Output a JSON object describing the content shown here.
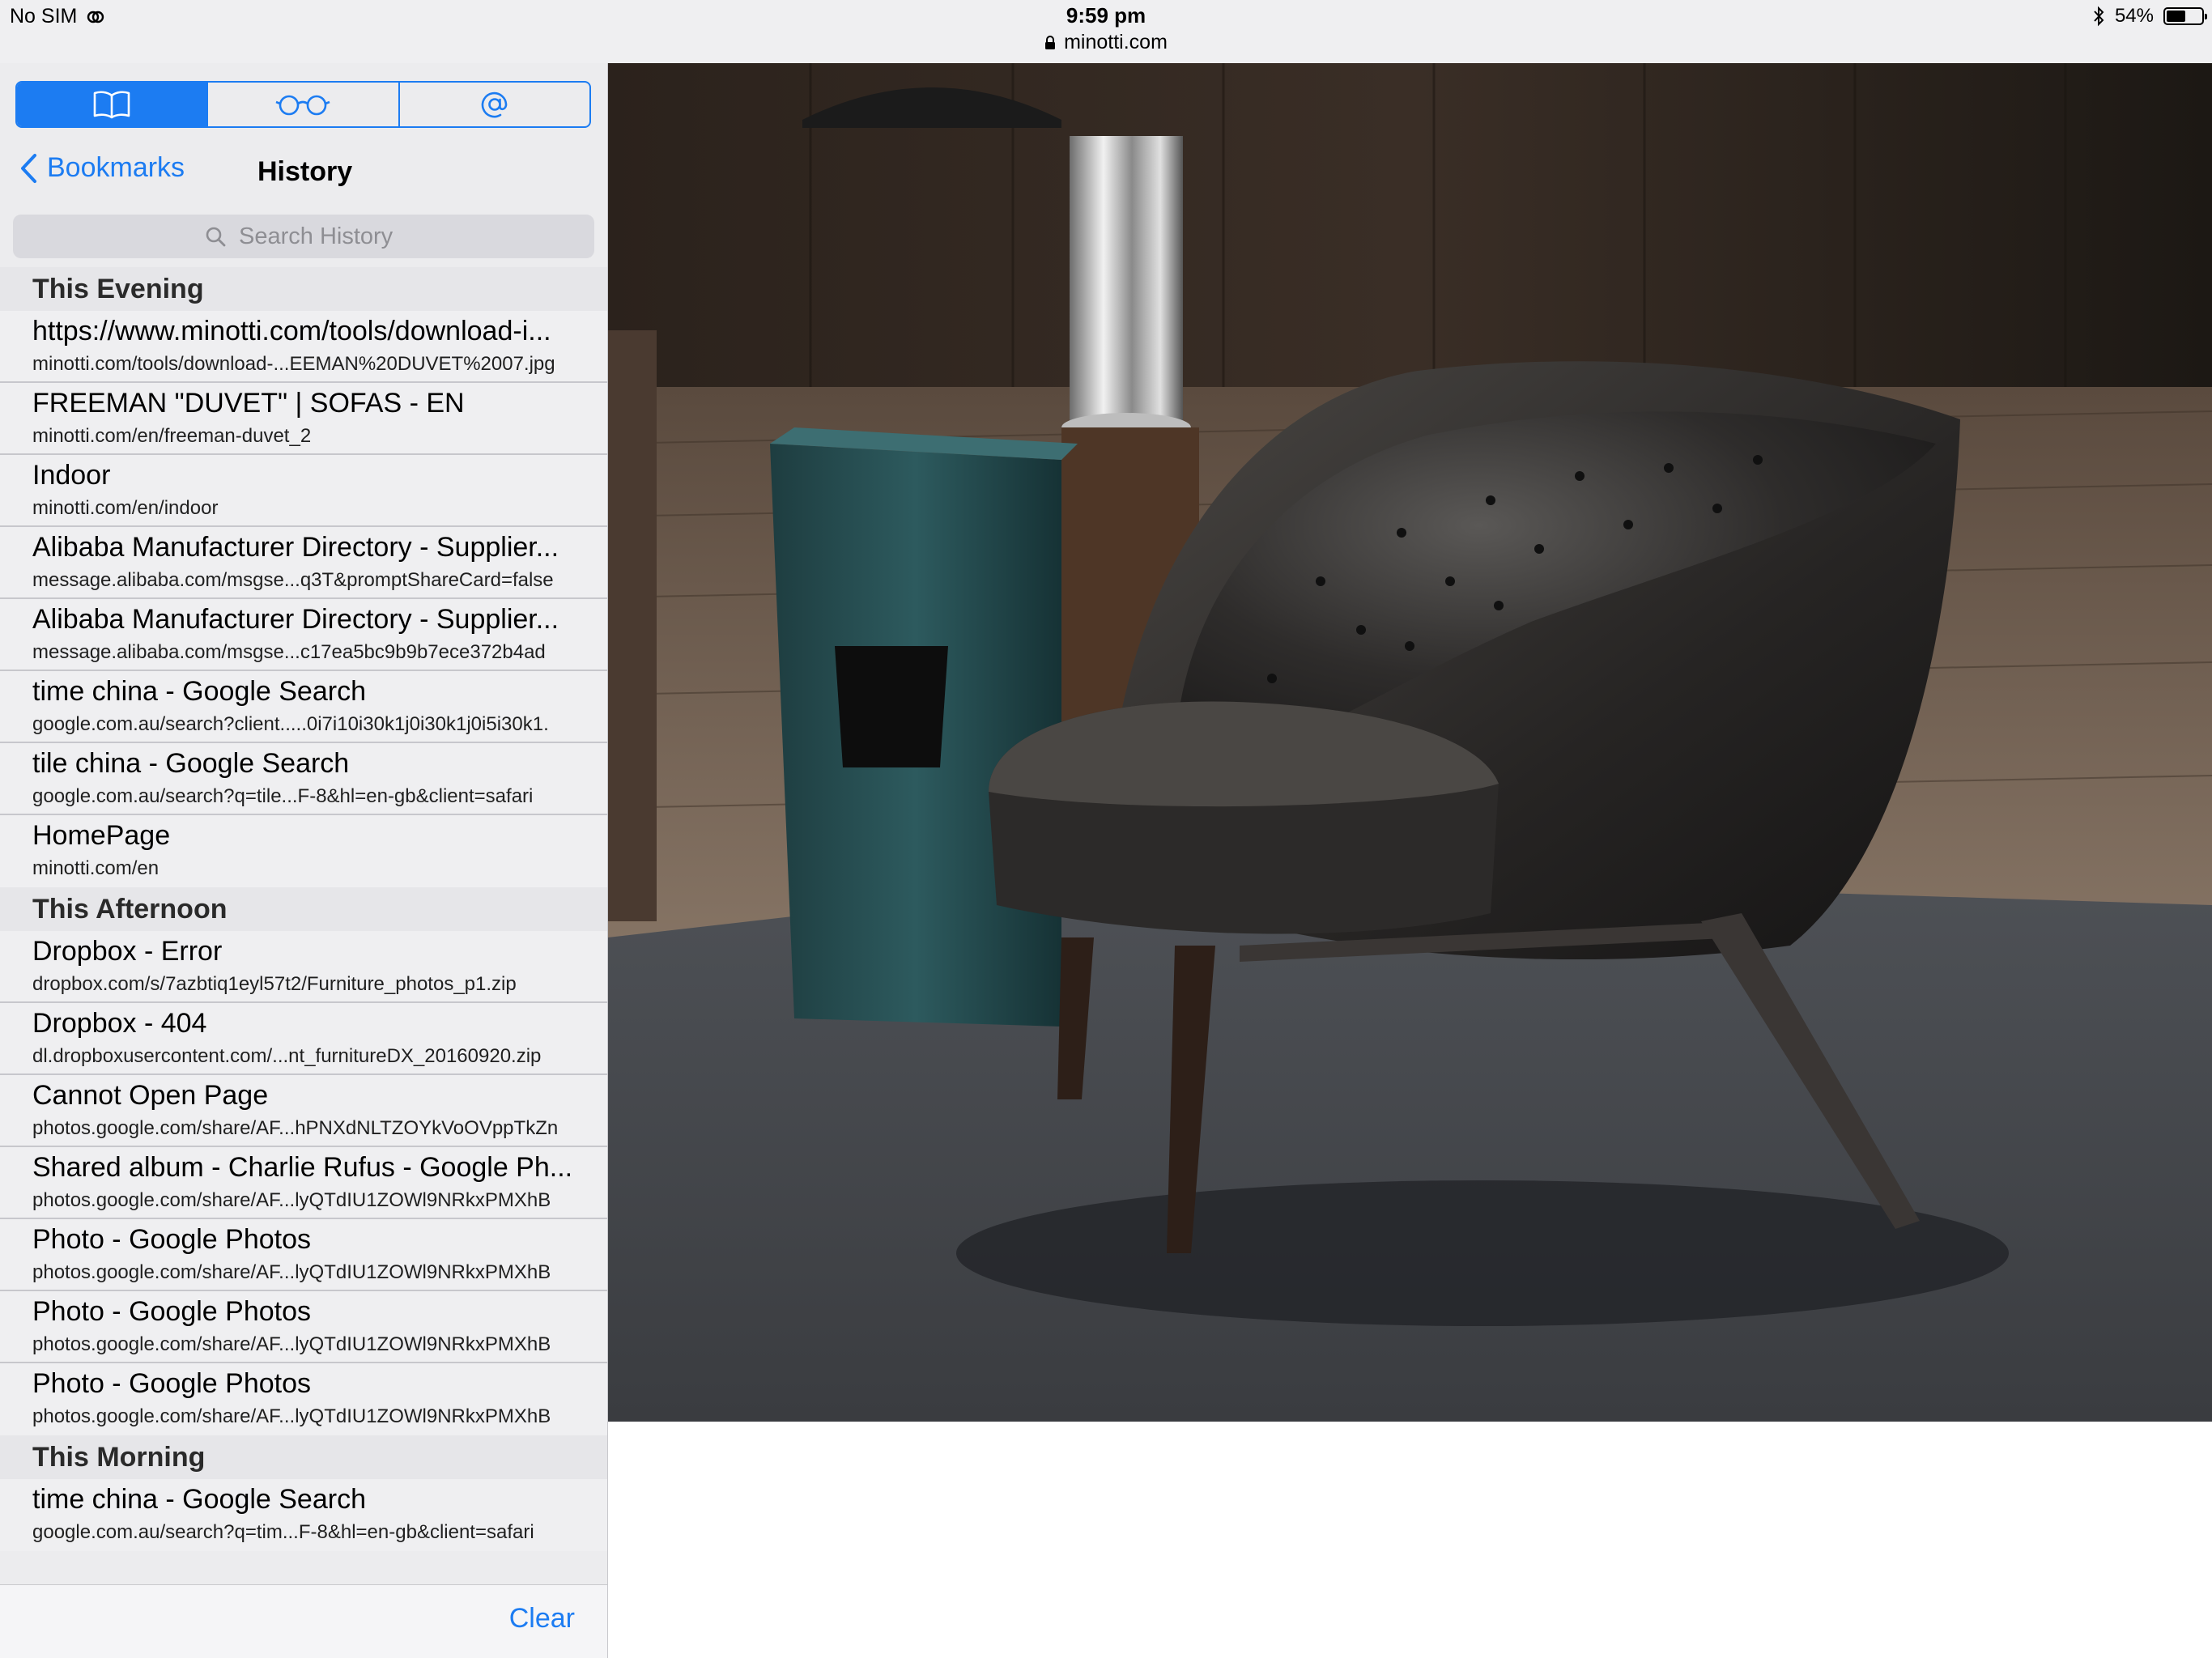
{
  "status_bar": {
    "carrier": "No SIM",
    "time": "9:59 pm",
    "url": "minotti.com",
    "battery": "54%",
    "battery_level": 0.54
  },
  "sidebar": {
    "tabs": [
      {
        "icon": "book-icon",
        "active": true
      },
      {
        "icon": "glasses-icon",
        "active": false
      },
      {
        "icon": "at-icon",
        "active": false
      }
    ],
    "back_label": "Bookmarks",
    "title": "History",
    "search_placeholder": "Search History",
    "clear_label": "Clear",
    "accent_color": "#1c7cf2",
    "sections": [
      {
        "label": "This Evening",
        "items": [
          {
            "title": "https://www.minotti.com/tools/download-i...",
            "url": "minotti.com/tools/download-...EEMAN%20DUVET%2007.jpg"
          },
          {
            "title": "FREEMAN \"DUVET\" | SOFAS - EN",
            "url": "minotti.com/en/freeman-duvet_2"
          },
          {
            "title": "Indoor",
            "url": "minotti.com/en/indoor"
          },
          {
            "title": "Alibaba Manufacturer Directory - Supplier...",
            "url": "message.alibaba.com/msgse...q3T&promptShareCard=false"
          },
          {
            "title": "Alibaba Manufacturer Directory - Supplier...",
            "url": "message.alibaba.com/msgse...c17ea5bc9b9b7ece372b4ad"
          },
          {
            "title": "time china - Google Search",
            "url": "google.com.au/search?client.....0i7i10i30k1j0i30k1j0i5i30k1."
          },
          {
            "title": "tile china - Google Search",
            "url": "google.com.au/search?q=tile...F-8&hl=en-gb&client=safari"
          },
          {
            "title": "HomePage",
            "url": "minotti.com/en"
          }
        ]
      },
      {
        "label": "This Afternoon",
        "items": [
          {
            "title": "Dropbox - Error",
            "url": "dropbox.com/s/7azbtiq1eyl57t2/Furniture_photos_p1.zip"
          },
          {
            "title": "Dropbox - 404",
            "url": "dl.dropboxusercontent.com/...nt_furnitureDX_20160920.zip"
          },
          {
            "title": "Cannot Open Page",
            "url": "photos.google.com/share/AF...hPNXdNLTZOYkVoOVppTkZn"
          },
          {
            "title": "Shared album - Charlie Rufus - Google Ph...",
            "url": "photos.google.com/share/AF...lyQTdIU1ZOWl9NRkxPMXhB"
          },
          {
            "title": "Photo - Google Photos",
            "url": "photos.google.com/share/AF...lyQTdIU1ZOWl9NRkxPMXhB"
          },
          {
            "title": "Photo - Google Photos",
            "url": "photos.google.com/share/AF...lyQTdIU1ZOWl9NRkxPMXhB"
          },
          {
            "title": "Photo - Google Photos",
            "url": "photos.google.com/share/AF...lyQTdIU1ZOWl9NRkxPMXhB"
          }
        ]
      },
      {
        "label": "This Morning",
        "items": [
          {
            "title": "time china - Google Search",
            "url": "google.com.au/search?q=tim...F-8&hl=en-gb&client=safari"
          }
        ]
      }
    ]
  }
}
